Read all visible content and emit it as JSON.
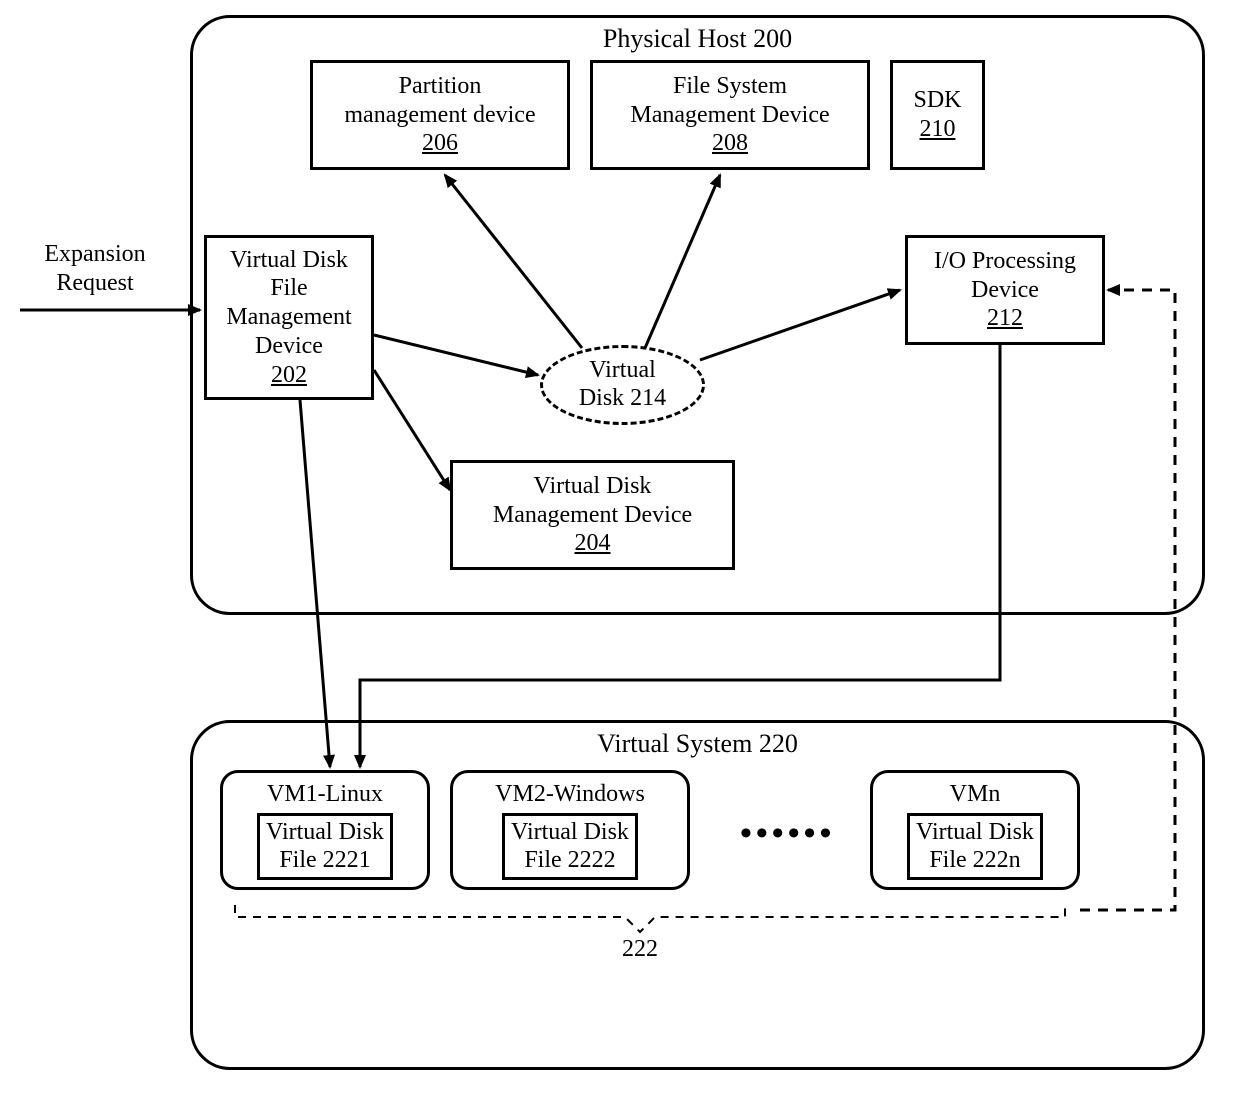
{
  "expansion_request": "Expansion\nRequest",
  "host": {
    "title": "Physical Host 200",
    "partition": {
      "label": "Partition\nmanagement device",
      "num": "206"
    },
    "filesystem": {
      "label": "File System\nManagement Device",
      "num": "208"
    },
    "sdk": {
      "label": "SDK",
      "num": "210"
    },
    "vdfm": {
      "label": "Virtual Disk\nFile\nManagement\nDevice",
      "num": "202"
    },
    "io": {
      "label": "I/O Processing\nDevice",
      "num": "212"
    },
    "vdisk": {
      "label": "Virtual\nDisk 214"
    },
    "vdm": {
      "label": "Virtual Disk\nManagement Device",
      "num": "204"
    }
  },
  "vs": {
    "title": "Virtual System 220",
    "vms": [
      {
        "name": "VM1-Linux",
        "file": "Virtual Disk\nFile 2221"
      },
      {
        "name": "VM2-Windows",
        "file": "Virtual Disk\nFile 2222"
      },
      {
        "name": "VMn",
        "file": "Virtual Disk\nFile 222n"
      }
    ],
    "group": "222"
  }
}
